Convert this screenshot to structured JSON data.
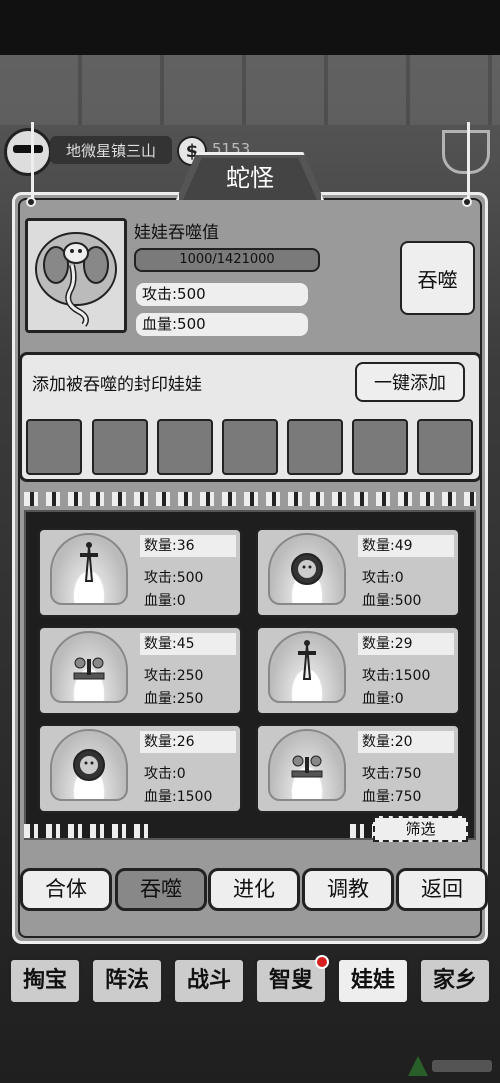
{
  "header": {
    "location": "地微星镇三山",
    "coins": "5153"
  },
  "panel": {
    "title": "蛇怪",
    "devour_label": "娃娃吞噬值",
    "progress": {
      "text": "1000/1421000",
      "fraction": 0.0007
    },
    "attack": "攻击:500",
    "hp": "血量:500",
    "devour_button": "吞噬"
  },
  "seal": {
    "title": "添加被吞噬的封印娃娃",
    "add_all_button": "一键添加",
    "slot_count": 7
  },
  "inventory": {
    "items": [
      {
        "icon": "sword-icon",
        "count": "数量:36",
        "attack": "攻击:500",
        "hp": "血量:0"
      },
      {
        "icon": "coin-face-icon",
        "count": "数量:49",
        "attack": "攻击:0",
        "hp": "血量:500"
      },
      {
        "icon": "scale-icon",
        "count": "数量:45",
        "attack": "攻击:250",
        "hp": "血量:250"
      },
      {
        "icon": "sword-icon",
        "count": "数量:29",
        "attack": "攻击:1500",
        "hp": "血量:0"
      },
      {
        "icon": "coin-face-icon",
        "count": "数量:26",
        "attack": "攻击:0",
        "hp": "血量:1500"
      },
      {
        "icon": "scale-icon",
        "count": "数量:20",
        "attack": "攻击:750",
        "hp": "血量:750"
      }
    ],
    "filter_button": "筛选"
  },
  "actions": [
    {
      "label": "合体",
      "active": false
    },
    {
      "label": "吞噬",
      "active": true
    },
    {
      "label": "进化",
      "active": false
    },
    {
      "label": "调教",
      "active": false
    },
    {
      "label": "返回",
      "active": false
    }
  ],
  "nav": [
    {
      "label": "掏宝",
      "active": false
    },
    {
      "label": "阵法",
      "active": false
    },
    {
      "label": "战斗",
      "active": false
    },
    {
      "label": "智叟",
      "active": false,
      "badge": true
    },
    {
      "label": "娃娃",
      "active": true
    },
    {
      "label": "家乡",
      "active": false
    }
  ],
  "colors": {
    "badge": "#d62020",
    "panel": "#9a9a9a",
    "background": "#2b2b2b"
  }
}
